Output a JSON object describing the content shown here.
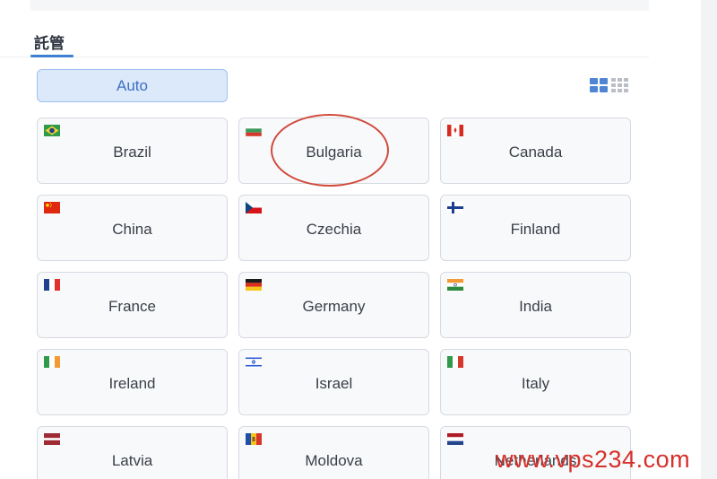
{
  "tabs": {
    "active_label": "託管"
  },
  "auto_button": {
    "label": "Auto"
  },
  "view_toggle": {
    "large_icon": "grid-large-icon",
    "small_icon": "grid-small-icon",
    "active": "large"
  },
  "countries": [
    {
      "name": "Brazil",
      "flag": "brazil"
    },
    {
      "name": "Bulgaria",
      "flag": "bulgaria",
      "highlighted": true
    },
    {
      "name": "Canada",
      "flag": "canada"
    },
    {
      "name": "China",
      "flag": "china"
    },
    {
      "name": "Czechia",
      "flag": "czechia"
    },
    {
      "name": "Finland",
      "flag": "finland"
    },
    {
      "name": "France",
      "flag": "france"
    },
    {
      "name": "Germany",
      "flag": "germany"
    },
    {
      "name": "India",
      "flag": "india"
    },
    {
      "name": "Ireland",
      "flag": "ireland"
    },
    {
      "name": "Israel",
      "flag": "israel"
    },
    {
      "name": "Italy",
      "flag": "italy"
    },
    {
      "name": "Latvia",
      "flag": "latvia"
    },
    {
      "name": "Moldova",
      "flag": "moldova"
    },
    {
      "name": "Netherlands",
      "flag": "netherlands"
    }
  ],
  "colors": {
    "accent": "#3f7fd1",
    "auto_bg": "#dce9fb",
    "highlight": "#d04a3c",
    "watermark": "#d6302a"
  },
  "watermark": "www.vps234.com"
}
